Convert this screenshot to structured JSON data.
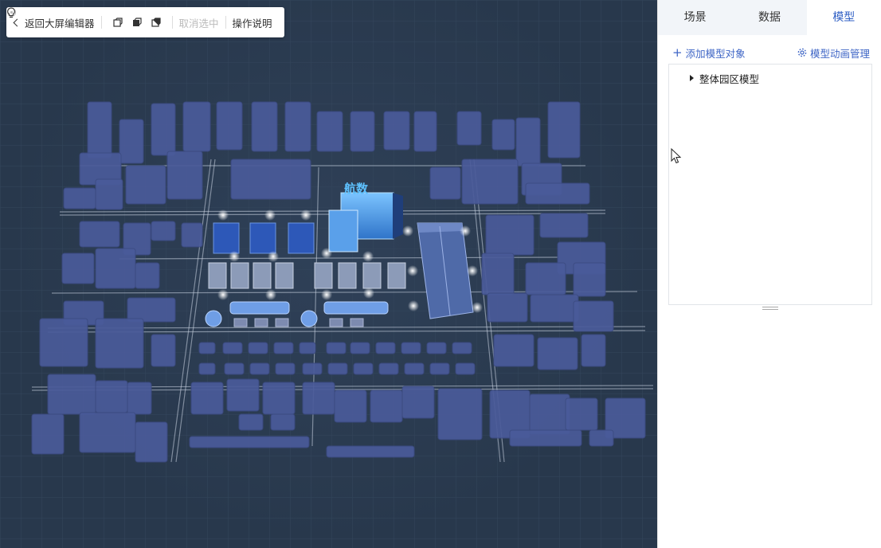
{
  "toolbar": {
    "back_label": "返回大屏编辑器",
    "cancel_selection_label": "取消选中",
    "help_label": "操作说明"
  },
  "panel": {
    "tabs": [
      {
        "label": "场景",
        "active": false
      },
      {
        "label": "数据",
        "active": false
      },
      {
        "label": "模型",
        "active": true
      }
    ],
    "add_model_label": "添加模型对象",
    "animation_label": "模型动画管理",
    "tree": [
      {
        "label": "整体园区模型",
        "expanded": false
      }
    ]
  },
  "scene": {
    "logo_text": "航数"
  },
  "colors": {
    "background": "#28384c",
    "accent": "#3f66c6",
    "building": "#4a5b9a",
    "highlight": "#5aa0ea"
  }
}
